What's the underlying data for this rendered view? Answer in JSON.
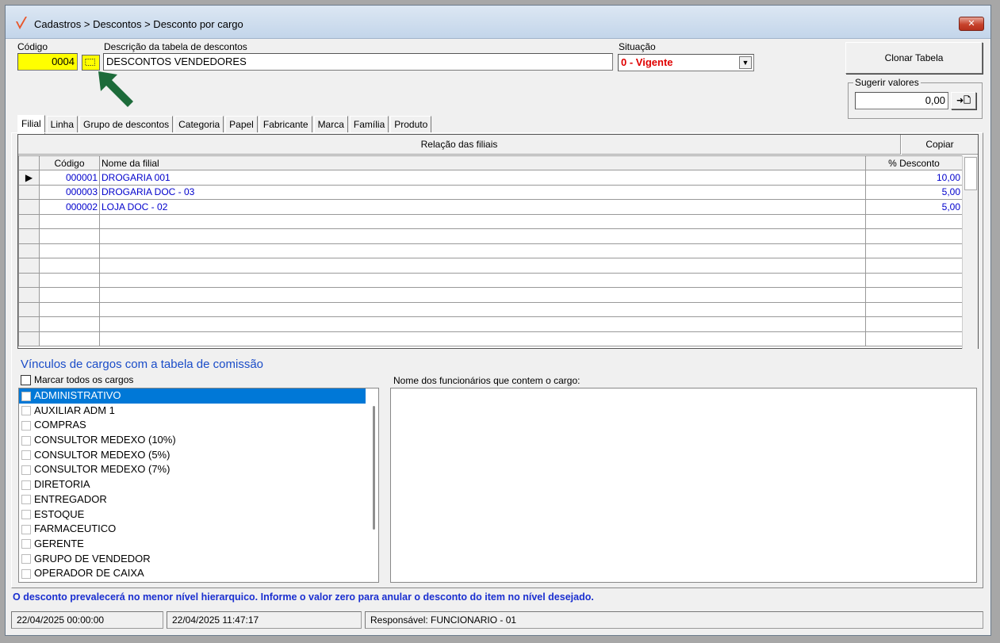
{
  "window": {
    "title": "Cadastros > Descontos > Desconto por cargo",
    "close_label": "✕"
  },
  "header": {
    "codigo_label": "Código",
    "codigo_value": "0004",
    "descricao_label": "Descrição da tabela de descontos",
    "descricao_value": "DESCONTOS VENDEDORES",
    "situacao_label": "Situação",
    "situacao_value": "0 - Vigente",
    "clonar_label": "Clonar Tabela",
    "sugerir_label": "Sugerir valores",
    "sugerir_value": "0,00",
    "sugerir_btn": "➜🗋"
  },
  "tabs": [
    "Filial",
    "Linha",
    "Grupo de descontos",
    "Categoria",
    "Papel",
    "Fabricante",
    "Marca",
    "Família",
    "Produto"
  ],
  "grid": {
    "caption": "Relação das filiais",
    "copy_label": "Copiar",
    "columns": [
      "Código",
      "Nome da filial",
      "% Desconto"
    ],
    "rows": [
      {
        "codigo": "000001",
        "nome": "DROGARIA 001",
        "desconto": "10,00"
      },
      {
        "codigo": "000003",
        "nome": "DROGARIA DOC - 03",
        "desconto": "5,00"
      },
      {
        "codigo": "000002",
        "nome": "LOJA  DOC - 02",
        "desconto": "5,00"
      }
    ]
  },
  "links": {
    "title": "Vínculos de cargos com a tabela de comissão",
    "mark_all_label": "Marcar todos os cargos",
    "employees_label": "Nome dos funcionários que contem o cargo:",
    "roles": [
      "ADMINISTRATIVO",
      "AUXILIAR ADM 1",
      "COMPRAS",
      "CONSULTOR MEDEXO (10%)",
      "CONSULTOR MEDEXO (5%)",
      "CONSULTOR MEDEXO (7%)",
      "DIRETORIA",
      "ENTREGADOR",
      "ESTOQUE",
      "FARMACEUTICO",
      "GERENTE",
      "GRUPO DE VENDEDOR",
      "OPERADOR DE CAIXA"
    ]
  },
  "notice": "O desconto prevalecerá no menor nível hierarquico. Informe o valor zero para anular o desconto do item no nível desejado.",
  "status": {
    "created": "22/04/2025 00:00:00",
    "updated": "22/04/2025 11:47:17",
    "responsavel": "Responsável: FUNCIONARIO - 01"
  },
  "colors": {
    "highlight_field": "#ffff00",
    "situacao_text": "#e00000",
    "link_blue": "#0000cc",
    "section_title": "#1a4cc8",
    "selected_row": "#0078d7",
    "arrow": "#1d6b3a"
  }
}
